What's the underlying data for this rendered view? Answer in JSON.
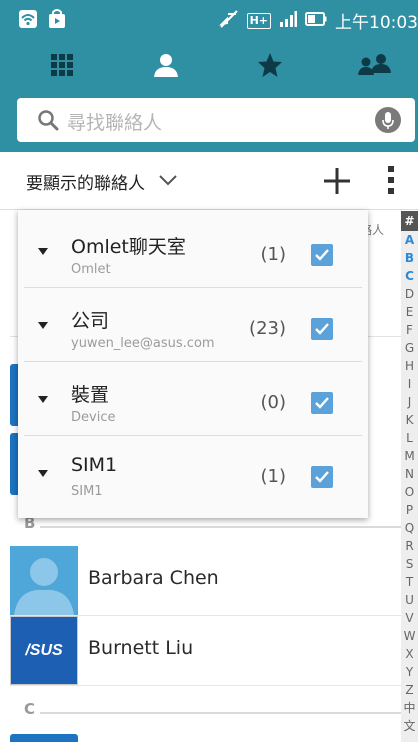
{
  "status_bar": {
    "time": "上午10:03",
    "network_label": "H+"
  },
  "tabs": [
    {
      "name": "dialer",
      "icon": "grid-icon",
      "active": false
    },
    {
      "name": "contacts",
      "icon": "person-icon",
      "active": true
    },
    {
      "name": "favorites",
      "icon": "star-icon",
      "active": false
    },
    {
      "name": "groups",
      "icon": "group-icon",
      "active": false
    }
  ],
  "search": {
    "placeholder": "尋找聯絡人"
  },
  "filter": {
    "label": "要顯示的聯絡人"
  },
  "dropdown": {
    "items": [
      {
        "name": "Omlet聊天室",
        "sub": "Omlet",
        "count": "(1)",
        "checked": true
      },
      {
        "name": "公司",
        "sub": "yuwen_lee@asus.com",
        "count": "(23)",
        "checked": true
      },
      {
        "name": "裝置",
        "sub": "Device",
        "count": "(0)",
        "checked": true
      },
      {
        "name": "SIM1",
        "sub": "SIM1",
        "count": "(1)",
        "checked": true
      }
    ]
  },
  "list": {
    "partial_header": "絡人",
    "sections": [
      {
        "letter": "B",
        "contacts": [
          {
            "name": "Barbara Chen",
            "avatar": "person-silhouette"
          },
          {
            "name": "Burnett Liu",
            "avatar": "asus-logo",
            "avatar_text": "/SUS"
          }
        ]
      },
      {
        "letter": "C",
        "contacts": []
      }
    ]
  },
  "index_bar": {
    "hash": "#",
    "letters": [
      "A",
      "B",
      "C",
      "D",
      "E",
      "F",
      "G",
      "H",
      "I",
      "J",
      "K",
      "L",
      "M",
      "N",
      "O",
      "P",
      "Q",
      "R",
      "S",
      "T",
      "U",
      "V",
      "W",
      "X",
      "Y",
      "Z",
      "中",
      "文"
    ],
    "active": [
      "A",
      "B",
      "C"
    ]
  },
  "colors": {
    "header": "#2f8fa3",
    "checkbox": "#5aa2d9",
    "index_active": "#2e89d6"
  }
}
